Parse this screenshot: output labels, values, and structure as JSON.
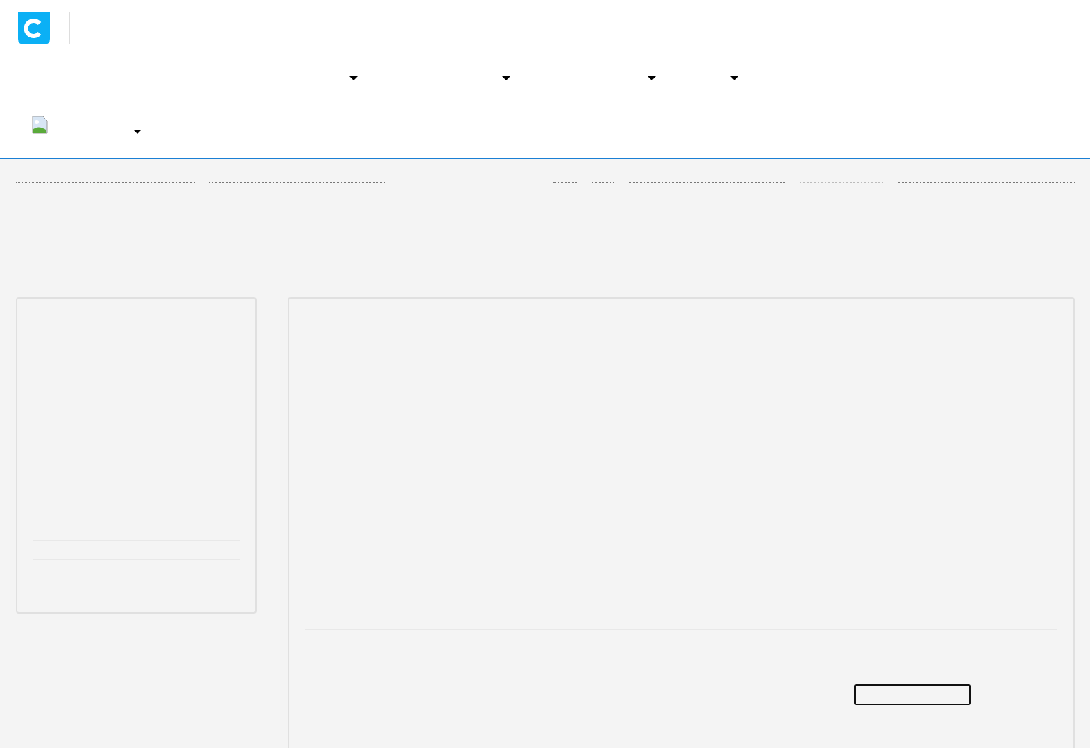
{
  "header": {
    "logo": {
      "kind": "logo"
    }
  },
  "nav": {
    "menus": [
      {
        "kind": "dropdown"
      },
      {
        "kind": "dropdown"
      },
      {
        "kind": "dropdown"
      },
      {
        "kind": "dropdown"
      }
    ]
  },
  "account": {
    "kind": "dropdown"
  },
  "links_left": [
    {
      "kind": "link",
      "disabled": false
    },
    {
      "kind": "link",
      "disabled": false
    }
  ],
  "links_right": [
    {
      "kind": "link",
      "disabled": false
    },
    {
      "kind": "link",
      "disabled": false
    },
    {
      "kind": "link",
      "disabled": false
    },
    {
      "kind": "link",
      "disabled": true
    },
    {
      "kind": "link",
      "disabled": false
    }
  ],
  "main_card": {
    "button": {
      "kind": "outline"
    }
  }
}
